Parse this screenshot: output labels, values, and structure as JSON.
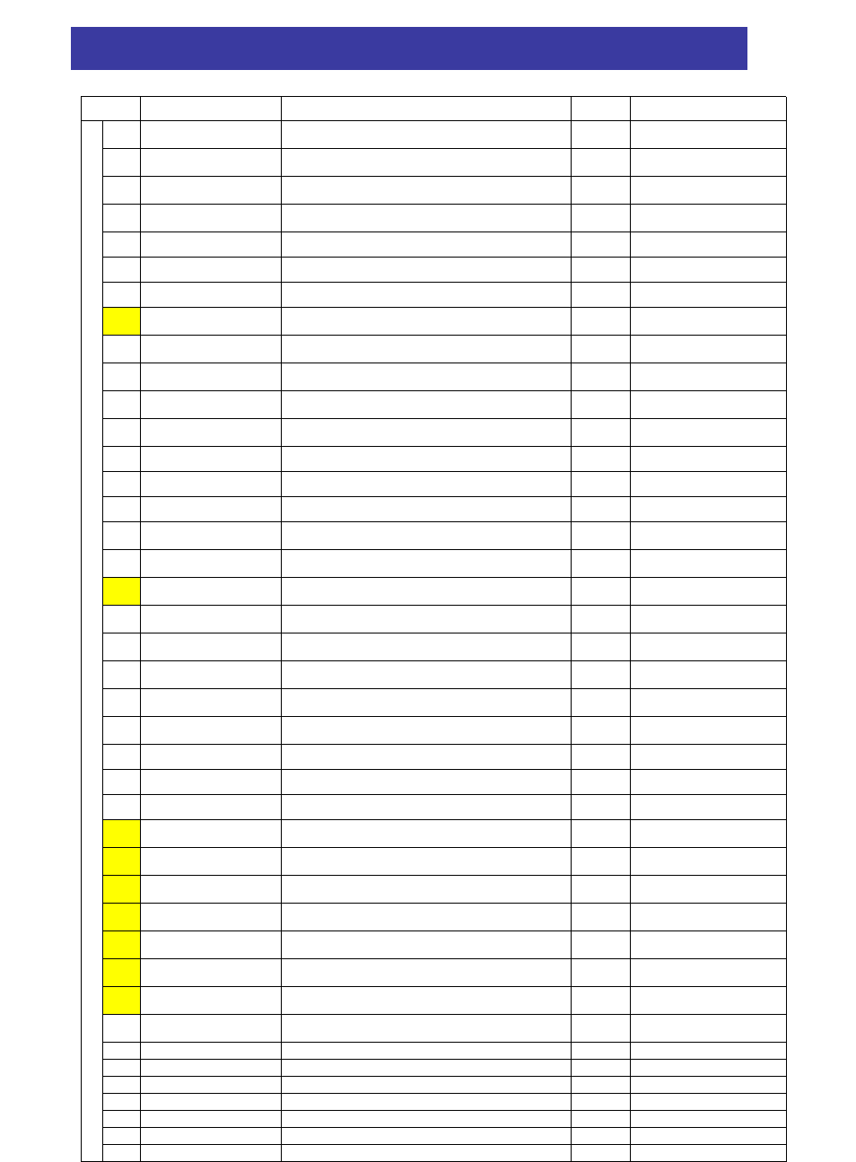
{
  "banner": {
    "title": ""
  },
  "columns": [
    {
      "id": "col-a",
      "label": ""
    },
    {
      "id": "col-b",
      "label": ""
    },
    {
      "id": "col-c",
      "label": ""
    },
    {
      "id": "col-d",
      "label": ""
    },
    {
      "id": "col-e",
      "label": ""
    },
    {
      "id": "col-f",
      "label": ""
    }
  ],
  "rows": [
    {
      "h": "tall",
      "b_highlight": false,
      "a": "",
      "b": "",
      "c": "",
      "d": "",
      "e": "",
      "f": ""
    },
    {
      "h": "tall",
      "b_highlight": false,
      "a": "",
      "b": "",
      "c": "",
      "d": "",
      "e": "",
      "f": ""
    },
    {
      "h": "tall",
      "b_highlight": false,
      "a": "",
      "b": "",
      "c": "",
      "d": "",
      "e": "",
      "f": ""
    },
    {
      "h": "tall",
      "b_highlight": false,
      "a": "",
      "b": "",
      "c": "",
      "d": "",
      "e": "",
      "f": ""
    },
    {
      "h": "mid",
      "b_highlight": false,
      "a": "",
      "b": "",
      "c": "",
      "d": "",
      "e": "",
      "f": ""
    },
    {
      "h": "mid",
      "b_highlight": false,
      "a": "",
      "b": "",
      "c": "",
      "d": "",
      "e": "",
      "f": ""
    },
    {
      "h": "mid",
      "b_highlight": false,
      "a": "",
      "b": "",
      "c": "",
      "d": "",
      "e": "",
      "f": ""
    },
    {
      "h": "tall",
      "b_highlight": true,
      "a": "",
      "b": "",
      "c": "",
      "d": "",
      "e": "",
      "f": ""
    },
    {
      "h": "tall",
      "b_highlight": false,
      "a": "",
      "b": "",
      "c": "",
      "d": "",
      "e": "",
      "f": ""
    },
    {
      "h": "tall",
      "b_highlight": false,
      "a": "",
      "b": "",
      "c": "",
      "d": "",
      "e": "",
      "f": ""
    },
    {
      "h": "tall",
      "b_highlight": false,
      "a": "",
      "b": "",
      "c": "",
      "d": "",
      "e": "",
      "f": ""
    },
    {
      "h": "tall",
      "b_highlight": false,
      "a": "",
      "b": "",
      "c": "",
      "d": "",
      "e": "",
      "f": ""
    },
    {
      "h": "mid",
      "b_highlight": false,
      "a": "",
      "b": "",
      "c": "",
      "d": "",
      "e": "",
      "f": ""
    },
    {
      "h": "mid",
      "b_highlight": false,
      "a": "",
      "b": "",
      "c": "",
      "d": "",
      "e": "",
      "f": ""
    },
    {
      "h": "mid",
      "b_highlight": false,
      "a": "",
      "b": "",
      "c": "",
      "d": "",
      "e": "",
      "f": ""
    },
    {
      "h": "tall",
      "b_highlight": false,
      "a": "",
      "b": "",
      "c": "",
      "d": "",
      "e": "",
      "f": ""
    },
    {
      "h": "tall",
      "b_highlight": false,
      "a": "",
      "b": "",
      "c": "",
      "d": "",
      "e": "",
      "f": ""
    },
    {
      "h": "tall",
      "b_highlight": true,
      "a": "",
      "b": "",
      "c": "",
      "d": "",
      "e": "",
      "f": ""
    },
    {
      "h": "tall",
      "b_highlight": false,
      "a": "",
      "b": "",
      "c": "",
      "d": "",
      "e": "",
      "f": ""
    },
    {
      "h": "tall",
      "b_highlight": false,
      "a": "",
      "b": "",
      "c": "",
      "d": "",
      "e": "",
      "f": ""
    },
    {
      "h": "tall",
      "b_highlight": false,
      "a": "",
      "b": "",
      "c": "",
      "d": "",
      "e": "",
      "f": ""
    },
    {
      "h": "tall",
      "b_highlight": false,
      "a": "",
      "b": "",
      "c": "",
      "d": "",
      "e": "",
      "f": ""
    },
    {
      "h": "tall",
      "b_highlight": false,
      "a": "",
      "b": "",
      "c": "",
      "d": "",
      "e": "",
      "f": ""
    },
    {
      "h": "mid",
      "b_highlight": false,
      "a": "",
      "b": "",
      "c": "",
      "d": "",
      "e": "",
      "f": ""
    },
    {
      "h": "mid",
      "b_highlight": false,
      "a": "",
      "b": "",
      "c": "",
      "d": "",
      "e": "",
      "f": ""
    },
    {
      "h": "mid",
      "b_highlight": false,
      "a": "",
      "b": "",
      "c": "",
      "d": "",
      "e": "",
      "f": ""
    },
    {
      "h": "tall",
      "b_highlight": true,
      "a": "",
      "b": "",
      "c": "",
      "d": "",
      "e": "",
      "f": ""
    },
    {
      "h": "tall",
      "b_highlight": true,
      "a": "",
      "b": "",
      "c": "",
      "d": "",
      "e": "",
      "f": ""
    },
    {
      "h": "tall",
      "b_highlight": true,
      "a": "",
      "b": "",
      "c": "",
      "d": "",
      "e": "",
      "f": ""
    },
    {
      "h": "tall",
      "b_highlight": true,
      "a": "",
      "b": "",
      "c": "",
      "d": "",
      "e": "",
      "f": ""
    },
    {
      "h": "tall",
      "b_highlight": true,
      "a": "",
      "b": "",
      "c": "",
      "d": "",
      "e": "",
      "f": ""
    },
    {
      "h": "tall",
      "b_highlight": true,
      "a": "",
      "b": "",
      "c": "",
      "d": "",
      "e": "",
      "f": ""
    },
    {
      "h": "tall",
      "b_highlight": true,
      "a": "",
      "b": "",
      "c": "",
      "d": "",
      "e": "",
      "f": ""
    },
    {
      "h": "tall",
      "b_highlight": false,
      "a": "",
      "b": "",
      "c": "",
      "d": "",
      "e": "",
      "f": ""
    },
    {
      "h": "short",
      "b_highlight": false,
      "a": "",
      "b": "",
      "c": "",
      "d": "",
      "e": "",
      "f": ""
    },
    {
      "h": "short",
      "b_highlight": false,
      "a": "",
      "b": "",
      "c": "",
      "d": "",
      "e": "",
      "f": ""
    },
    {
      "h": "short",
      "b_highlight": false,
      "a": "",
      "b": "",
      "c": "",
      "d": "",
      "e": "",
      "f": ""
    },
    {
      "h": "short",
      "b_highlight": false,
      "a": "",
      "b": "",
      "c": "",
      "d": "",
      "e": "",
      "f": ""
    },
    {
      "h": "short",
      "b_highlight": false,
      "a": "",
      "b": "",
      "c": "",
      "d": "",
      "e": "",
      "f": ""
    },
    {
      "h": "short",
      "b_highlight": false,
      "a": "",
      "b": "",
      "c": "",
      "d": "",
      "e": "",
      "f": ""
    },
    {
      "h": "short",
      "b_highlight": false,
      "a": "",
      "b": "",
      "c": "",
      "d": "",
      "e": "",
      "f": ""
    }
  ]
}
